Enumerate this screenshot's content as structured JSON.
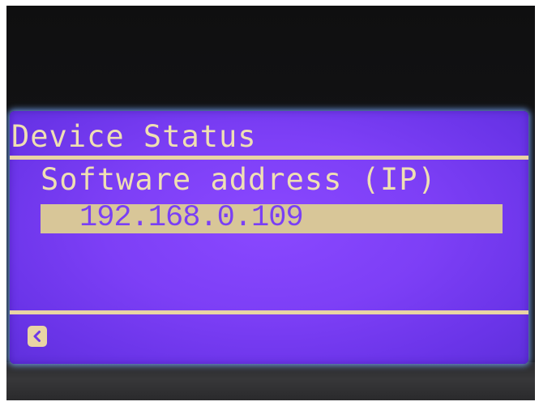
{
  "screen": {
    "title": "Device Status",
    "field_label": "Software address (IP)",
    "field_value": "192.168.0.109",
    "back_icon": "chevron-left-icon"
  },
  "colors": {
    "screen_background": "#7d3ff6",
    "text": "#efdfb3",
    "highlight": "#d8c698",
    "highlight_text": "#7a3ff5",
    "bezel": "#151517"
  }
}
